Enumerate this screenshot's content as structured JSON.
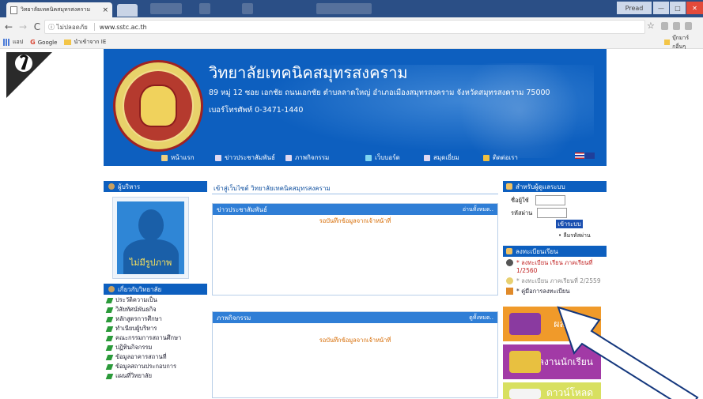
{
  "browser": {
    "tab_title": "วิทยาลัยเทคนิคสมุทรสงคราม",
    "tab_close": "×",
    "window_user": "Pread",
    "window_controls": {
      "min": "—",
      "max": "□",
      "close": "✕"
    },
    "nav": {
      "back": "←",
      "forward": "→",
      "reload": "C"
    },
    "security_label": "ⓘ ไม่ปลอดภัย",
    "url": "www.sstc.ac.th",
    "bookmarks": {
      "apps": "แอป",
      "google": "Google",
      "imported": "นำเข้าจาก IE",
      "other": "บุ๊กมาร์กอื่นๆ"
    }
  },
  "site": {
    "title": "วิทยาลัยเทคนิคสมุทรสงคราม",
    "address": "89 หมู่ 12 ซอย เอกชัย ถนนเอกชัย ตำบลลาดใหญ่ อำเภอเมืองสมุทรสงคราม จังหวัดสมุทรสงคราม 75000",
    "phone": "เบอร์โทรศัพท์ 0-3471-1440",
    "nav": [
      "หน้าแรก",
      "ข่าวประชาสัมพันธ์",
      "ภาพกิจกรรม",
      "เว็บบอร์ด",
      "สมุดเยี่ยม",
      "ติดต่อเรา"
    ]
  },
  "left": {
    "admin_header": "ผู้บริหาร",
    "no_image": "ไม่มีรูปภาพ",
    "about_header": "เกี่ยวกับวิทยาลัย",
    "about_items": [
      "ประวัติความเป็น",
      "วิสัยทัศน์พันธกิจ",
      "หลักสูตรการศึกษา",
      "ทำเนียบผู้บริหาร",
      "คณะกรรมการสถานศึกษา",
      "ปฏิทินกิจกรรม",
      "ข้อมูลอาคารสถานที่",
      "ข้อมูลสถานประกอบการ",
      "แผนที่วิทยาลัย"
    ]
  },
  "main": {
    "welcome": "เข้าสู่เว็บไซต์ วิทยาลัยเทคนิคสมุทรสงคราม",
    "news_header": "ข่าวประชาสัมพันธ์",
    "news_more": "อ่านทั้งหมด..",
    "news_msg": "รอบันทึกข้อมูลจากเจ้าหน้าที่",
    "activity_header": "ภาพกิจกรรม",
    "activity_more": "ดูทั้งหมด..",
    "activity_msg": "รอบันทึกข้อมูลจากเจ้าหน้าที่"
  },
  "right": {
    "login_header": "สำหรับผู้ดูแลระบบ",
    "username_label": "ชื่อผู้ใช้",
    "password_label": "รหัสผ่าน",
    "login_button": "เข้าระบบ",
    "forgot": "• ลืมรหัสผ่าน",
    "register_header": "ลงทะเบียนเรียน",
    "reg1": "* ลงทะเบียน เรียน ภาคเรียนที่ 1/2560",
    "reg2": "* ลงทะเบียน ภาคเรียนที่ 2/2559",
    "reg_manual": "* คู่มือการลงทะเบียน",
    "tiles": [
      "ผลงานครู",
      "ผลงานนักเรียน",
      "ดาวน์โหลด"
    ]
  }
}
